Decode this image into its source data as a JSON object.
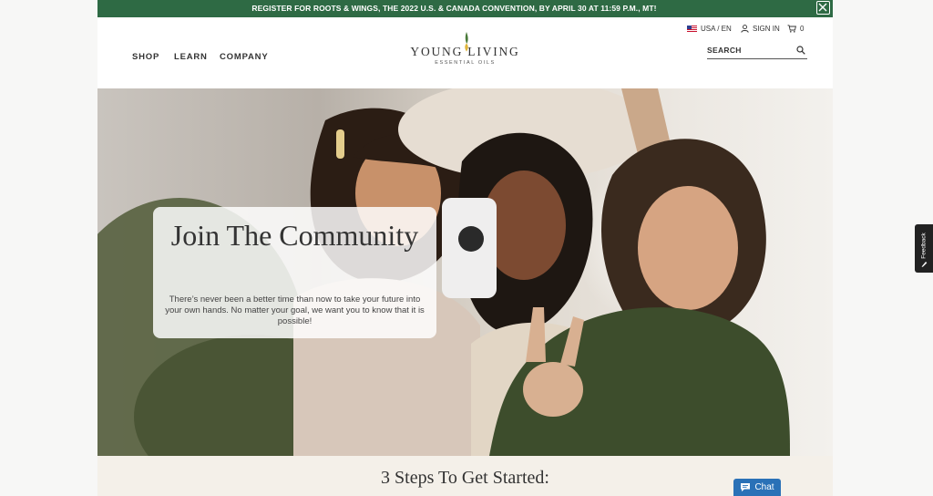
{
  "promo": {
    "text": "REGISTER FOR ROOTS & WINGS, THE 2022 U.S. & CANADA CONVENTION, BY APRIL 30 AT 11:59 P.M., MT!",
    "close_icon": "close-icon"
  },
  "header": {
    "locale": "USA / EN",
    "sign_in": "SIGN IN",
    "cart_count": "0",
    "nav": [
      "SHOP",
      "LEARN",
      "COMPANY"
    ],
    "logo_main": "YOUNG LIVING",
    "logo_sub": "ESSENTIAL OILS",
    "search_placeholder": "SEARCH",
    "icons": [
      "us-flag-icon",
      "user-icon",
      "cart-icon",
      "search-icon",
      "oil-drop-logo-icon"
    ]
  },
  "hero": {
    "title": "Join The Community",
    "body": "There’s never been a better time than now to take your future into your own hands. No matter your goal, we want you to know that it is possible!"
  },
  "steps": {
    "title": "3 Steps To Get Started:"
  },
  "feedback": {
    "label": "Feedback"
  },
  "chat": {
    "label": "Chat"
  },
  "colors": {
    "promo_bar": "#2e6a44",
    "chat_button": "#2a71b7",
    "feedback_tab": "#222222",
    "steps_background": "#f4f0e9"
  }
}
